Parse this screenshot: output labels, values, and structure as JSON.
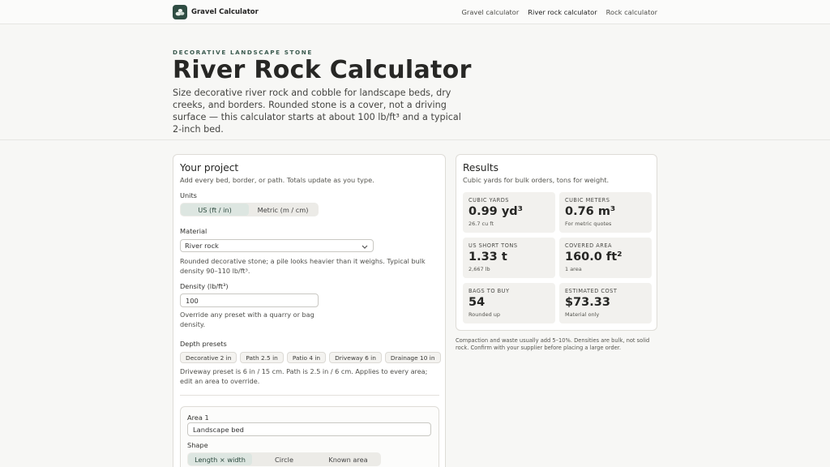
{
  "header": {
    "brand_name": "Gravel Calculator",
    "nav": [
      "Gravel calculator",
      "River rock calculator",
      "Rock calculator"
    ],
    "active_nav": "River rock calculator"
  },
  "hero": {
    "eyebrow": "DECORATIVE LANDSCAPE STONE",
    "title": "River Rock Calculator",
    "lede": "Size decorative river rock and cobble for landscape beds, dry creeks, and borders. Rounded stone is a cover, not a driving surface — this calculator starts at about 100 lb/ft³ and a typical 2-inch bed."
  },
  "project": {
    "title": "Your project",
    "subtitle": "Add every bed, border, or path. Totals update as you type.",
    "units_label": "Units",
    "units_options": [
      "US (ft / in)",
      "Metric (m / cm)"
    ],
    "units_selected": "US (ft / in)",
    "material_label": "Material",
    "material_value": "River rock",
    "material_help": "Rounded decorative stone; a pile looks heavier than it weighs. Typical bulk density 90–110 lb/ft³.",
    "density_label": "Density (lb/ft³)",
    "density_value": "100",
    "density_help": "Override any preset with a quarry or bag density.",
    "depth_label": "Depth presets",
    "depth_presets": [
      "Decorative 2 in",
      "Path 2.5 in",
      "Patio 4 in",
      "Driveway 6 in",
      "Drainage 10 in"
    ],
    "depth_help": "Driveway preset is 6 in / 15 cm. Path is 2.5 in / 6 cm. Applies to every area; edit an area to override.",
    "area": {
      "title": "Area 1",
      "name_value": "Landscape bed",
      "shape_label": "Shape",
      "shape_options": [
        "Length × width",
        "Circle",
        "Known area"
      ],
      "shape_selected": "Length × width"
    }
  },
  "results": {
    "title": "Results",
    "subtitle": "Cubic yards for bulk orders, tons for weight.",
    "tiles": [
      {
        "label": "CUBIC YARDS",
        "value": "0.99 yd³",
        "sub": "26.7 cu ft"
      },
      {
        "label": "CUBIC METERS",
        "value": "0.76 m³",
        "sub": "For metric quotes"
      },
      {
        "label": "US SHORT TONS",
        "value": "1.33 t",
        "sub": "2,667 lb"
      },
      {
        "label": "COVERED AREA",
        "value": "160.0 ft²",
        "sub": "1 area"
      },
      {
        "label": "BAGS TO BUY",
        "value": "54",
        "sub": "Rounded up"
      },
      {
        "label": "ESTIMATED COST",
        "value": "$73.33",
        "sub": "Material only"
      }
    ],
    "note": "Compaction and waste usually add 5–10%. Densities are bulk, not solid rock. Confirm with your supplier before placing a large order."
  },
  "colors": {
    "brand": "#2f4d43",
    "selected_segment": "#dde6e1",
    "tile_bg": "#f2f1ee",
    "page_bg": "#f7f7f5"
  },
  "icons": {
    "logo": "rocks-icon",
    "select_chevron": "chevron-down-icon"
  }
}
